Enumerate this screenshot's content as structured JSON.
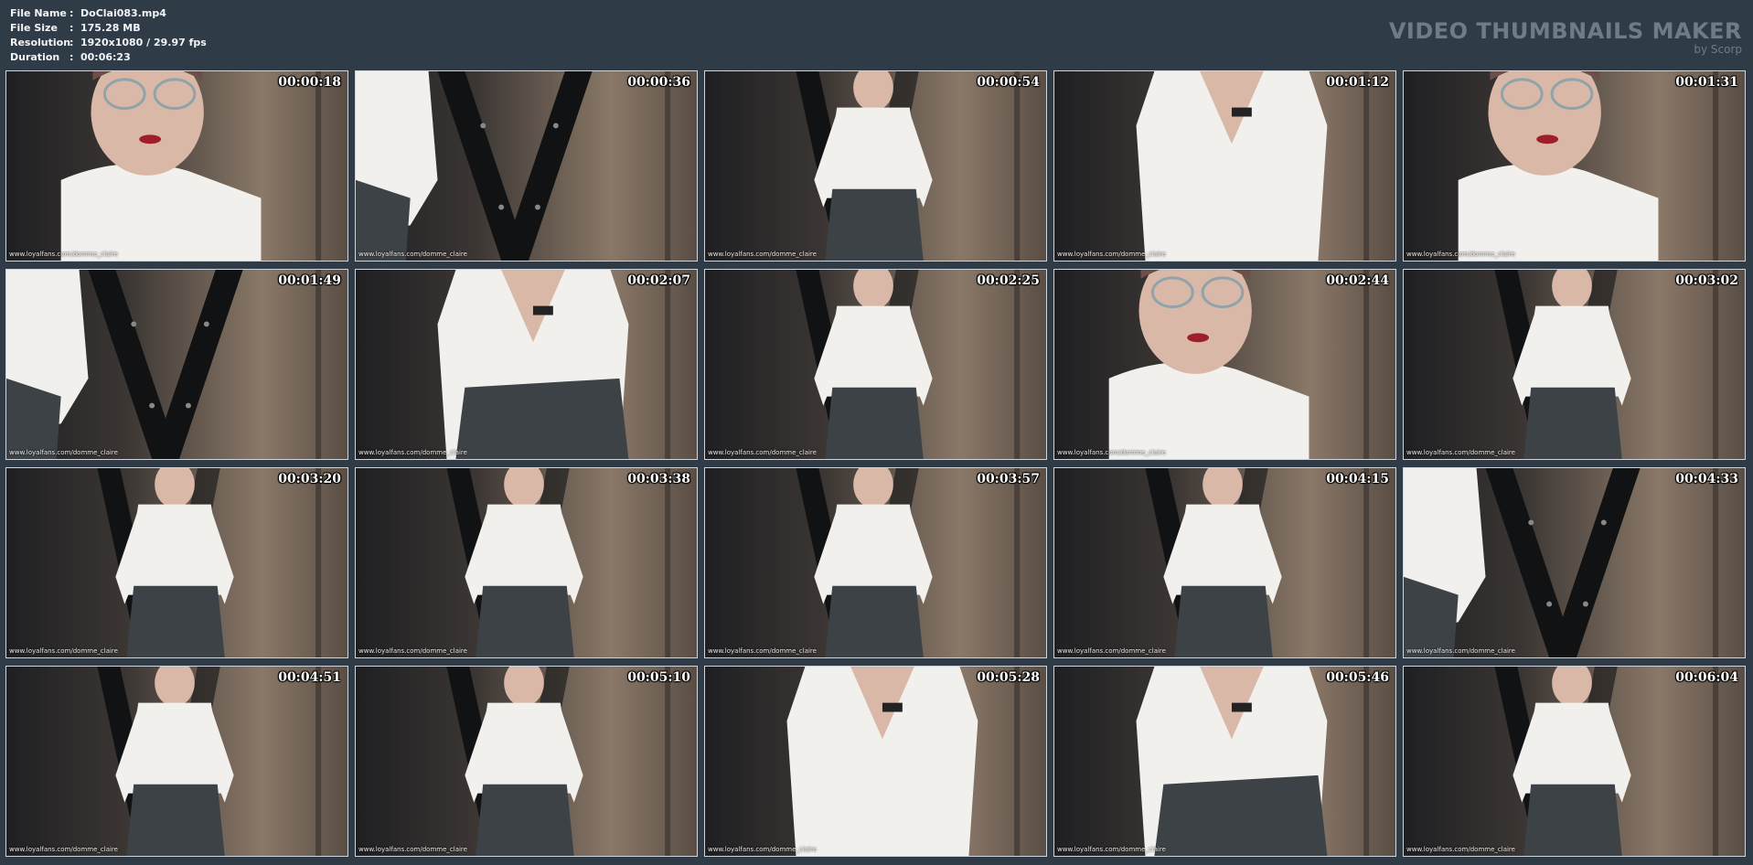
{
  "file_info": {
    "rows": [
      {
        "label": "File Name",
        "value": "DoClai083.mp4"
      },
      {
        "label": "File Size",
        "value": "175.28 MB"
      },
      {
        "label": "Resolution",
        "value": "1920x1080 / 29.97 fps"
      },
      {
        "label": "Duration",
        "value": "00:06:23"
      }
    ],
    "separator": ":"
  },
  "brand": {
    "title": "VIDEO THUMBNAILS MAKER",
    "subtitle": "by Scorp"
  },
  "watermark": "www.loyalfans.com/domme_claire",
  "thumbnails": [
    {
      "time": "00:00:18",
      "scene": "closeup-face"
    },
    {
      "time": "00:00:36",
      "scene": "cross-arm"
    },
    {
      "time": "00:00:54",
      "scene": "standing"
    },
    {
      "time": "00:01:12",
      "scene": "torso"
    },
    {
      "time": "00:01:31",
      "scene": "closeup-face"
    },
    {
      "time": "00:01:49",
      "scene": "cross-arm"
    },
    {
      "time": "00:02:07",
      "scene": "torso-skirt"
    },
    {
      "time": "00:02:25",
      "scene": "standing"
    },
    {
      "time": "00:02:44",
      "scene": "closeup-face"
    },
    {
      "time": "00:03:02",
      "scene": "standing"
    },
    {
      "time": "00:03:20",
      "scene": "standing"
    },
    {
      "time": "00:03:38",
      "scene": "standing"
    },
    {
      "time": "00:03:57",
      "scene": "standing"
    },
    {
      "time": "00:04:15",
      "scene": "standing"
    },
    {
      "time": "00:04:33",
      "scene": "cross-arm"
    },
    {
      "time": "00:04:51",
      "scene": "standing"
    },
    {
      "time": "00:05:10",
      "scene": "standing"
    },
    {
      "time": "00:05:28",
      "scene": "torso"
    },
    {
      "time": "00:05:46",
      "scene": "torso-skirt"
    },
    {
      "time": "00:06:04",
      "scene": "standing"
    }
  ],
  "colors": {
    "background": "#2f3b47",
    "header_text": "#f2f4f6",
    "brand_text": "#6f7b87",
    "thumb_border": "#cfd5db"
  }
}
